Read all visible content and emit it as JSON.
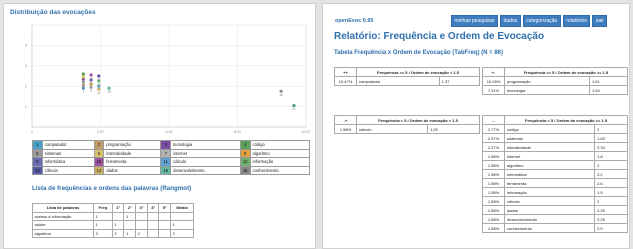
{
  "left": {
    "chart_title": "Distribuição das evocações",
    "list_title": "Lista de frequências e ordens das palavras (Rangmot)"
  },
  "chart_data": {
    "type": "scatter",
    "xlim": [
      0,
      10.67
    ],
    "ylim": [
      0,
      5
    ],
    "x_ticks": [
      "0",
      "2.67",
      "5.34",
      "8.01",
      "10.67"
    ],
    "y_ticks": [
      "4",
      "3",
      "2",
      "1"
    ],
    "grid": true,
    "points": [
      {
        "id": 1,
        "x": 2.0,
        "y": 1.9,
        "color": "#4aa0c8"
      },
      {
        "id": 2,
        "x": 2.0,
        "y": 2.05,
        "color": "#c49a6c"
      },
      {
        "id": 3,
        "x": 2.0,
        "y": 2.35,
        "color": "#7b4ea6"
      },
      {
        "id": 4,
        "x": 2.0,
        "y": 2.6,
        "color": "#5aa05a"
      },
      {
        "id": 5,
        "x": 2.0,
        "y": 2.2,
        "color": "#9a9a9a"
      },
      {
        "id": 6,
        "x": 2.0,
        "y": 2.45,
        "color": "#d6c26a"
      },
      {
        "id": 7,
        "x": 2.3,
        "y": 1.95,
        "color": "#b0b0b0"
      },
      {
        "id": 8,
        "x": 2.3,
        "y": 2.1,
        "color": "#e0a040"
      },
      {
        "id": 9,
        "x": 2.3,
        "y": 2.3,
        "color": "#6a6ab0"
      },
      {
        "id": 10,
        "x": 2.3,
        "y": 2.55,
        "color": "#a050a0"
      },
      {
        "id": 11,
        "x": 2.6,
        "y": 2.0,
        "color": "#60a0d0"
      },
      {
        "id": 12,
        "x": 2.6,
        "y": 2.25,
        "color": "#70b070"
      },
      {
        "id": 13,
        "x": 2.6,
        "y": 2.5,
        "color": "#5858a8"
      },
      {
        "id": 14,
        "x": 2.6,
        "y": 1.85,
        "color": "#c8b060"
      },
      {
        "id": 15,
        "x": 3.0,
        "y": 1.9,
        "color": "#60b8a0"
      },
      {
        "id": 16,
        "x": 9.7,
        "y": 1.75,
        "color": "#888888"
      },
      {
        "id": 17,
        "x": 10.2,
        "y": 1.05,
        "color": "#4aa070"
      }
    ],
    "point_labels": [
      "1",
      "2",
      "3",
      "11",
      "12",
      "4",
      "5",
      "6",
      "13",
      "14",
      "7",
      "10",
      "8",
      "9",
      "15",
      "16",
      "17"
    ]
  },
  "legend": [
    [
      {
        "n": "1",
        "label": "computador",
        "color": "#4aa0c8"
      },
      {
        "n": "2",
        "label": "programação",
        "color": "#c49a6c"
      },
      {
        "n": "3",
        "label": "tecnologia",
        "color": "#7b4ea6"
      },
      {
        "n": "4",
        "label": "código",
        "color": "#5aa05a"
      }
    ],
    [
      {
        "n": "5",
        "label": "sistemas",
        "color": "#9a9a9a"
      },
      {
        "n": "6",
        "label": "interatividade",
        "color": "#d6c26a"
      },
      {
        "n": "7",
        "label": "internet",
        "color": "#b0b0b0"
      },
      {
        "n": "8",
        "label": "algoritmo",
        "color": "#e0a040"
      }
    ],
    [
      {
        "n": "9",
        "label": "informática",
        "color": "#6a6ab0"
      },
      {
        "n": "10",
        "label": "ferramenta",
        "color": "#a050a0"
      },
      {
        "n": "11",
        "label": "cálculo",
        "color": "#60a0d0"
      },
      {
        "n": "12",
        "label": "informação",
        "color": "#70b070"
      }
    ],
    [
      {
        "n": "13",
        "label": "ciência",
        "color": "#5858a8"
      },
      {
        "n": "14",
        "label": "dados",
        "color": "#c8b060"
      },
      {
        "n": "15",
        "label": "desenvolvimento",
        "color": "#60b8a0"
      },
      {
        "n": "16",
        "label": "conhecimento",
        "color": "#888888"
      }
    ]
  ],
  "freq_table": {
    "headers": [
      "Lista de palavras",
      "Freq",
      "1°",
      "2°",
      "3°",
      "4°",
      "5°",
      "Média"
    ],
    "rows": [
      [
        "acesso à informação",
        "1",
        "",
        "1",
        "",
        "",
        "",
        ""
      ],
      [
        "adobe",
        "1",
        "1",
        "",
        "",
        "",
        "",
        "1"
      ],
      [
        "algoritmo",
        "3",
        "2",
        "1",
        "2",
        "",
        "",
        "2"
      ]
    ]
  },
  "right": {
    "app_title": "openEvoc 0.95",
    "nav": [
      "minhas pesquisas",
      "dados",
      "categorização",
      "relatórios",
      "sair"
    ],
    "report_title": "Relatório: Frequência e Ordem de Evocação",
    "table_caption": "Tabela Frequência x Ordem de Evocação (TabFreq) (N = 86)"
  },
  "quadrants": {
    "q1": {
      "arrow": "++",
      "header": "Frequência >= 5 / Ordem de evocação < 1.5",
      "rows": [
        [
          "10.47%",
          "computador",
          "1.37"
        ]
      ]
    },
    "q2": {
      "arrow": "+-",
      "header": "Frequência >= 5 / Ordem de evocação >= 1.5",
      "rows": [
        [
          "10.26%",
          "programação",
          "1.61"
        ],
        [
          "7.11%",
          "tecnologia",
          "1.94"
        ]
      ]
    },
    "q3": {
      "arrow": "-+",
      "header": "Frequência < 5 / Ordem de evocação < 1.5",
      "rows": [
        [
          "1.58%",
          "cálculo",
          "1.25"
        ]
      ]
    },
    "q4": {
      "arrow": "--",
      "header": "Frequência < 5 / Ordem de evocação >= 1.5",
      "rows": [
        [
          "2.77%",
          "código",
          "2"
        ],
        [
          "2.37%",
          "sistemas",
          "1.83"
        ],
        [
          "2.37%",
          "interatividade",
          "2.33"
        ],
        [
          "1.98%",
          "internet",
          "1.8"
        ],
        [
          "1.98%",
          "algoritmo",
          "2"
        ],
        [
          "1.98%",
          "informática",
          "2.2"
        ],
        [
          "1.98%",
          "ferramenta",
          "2.6"
        ],
        [
          "1.58%",
          "informação",
          "1.5"
        ],
        [
          "1.58%",
          "ciência",
          "2"
        ],
        [
          "1.58%",
          "dados",
          "2.25"
        ],
        [
          "1.58%",
          "desenvolvimento",
          "2.25"
        ],
        [
          "1.58%",
          "conhecimento",
          "2.5"
        ]
      ]
    }
  }
}
